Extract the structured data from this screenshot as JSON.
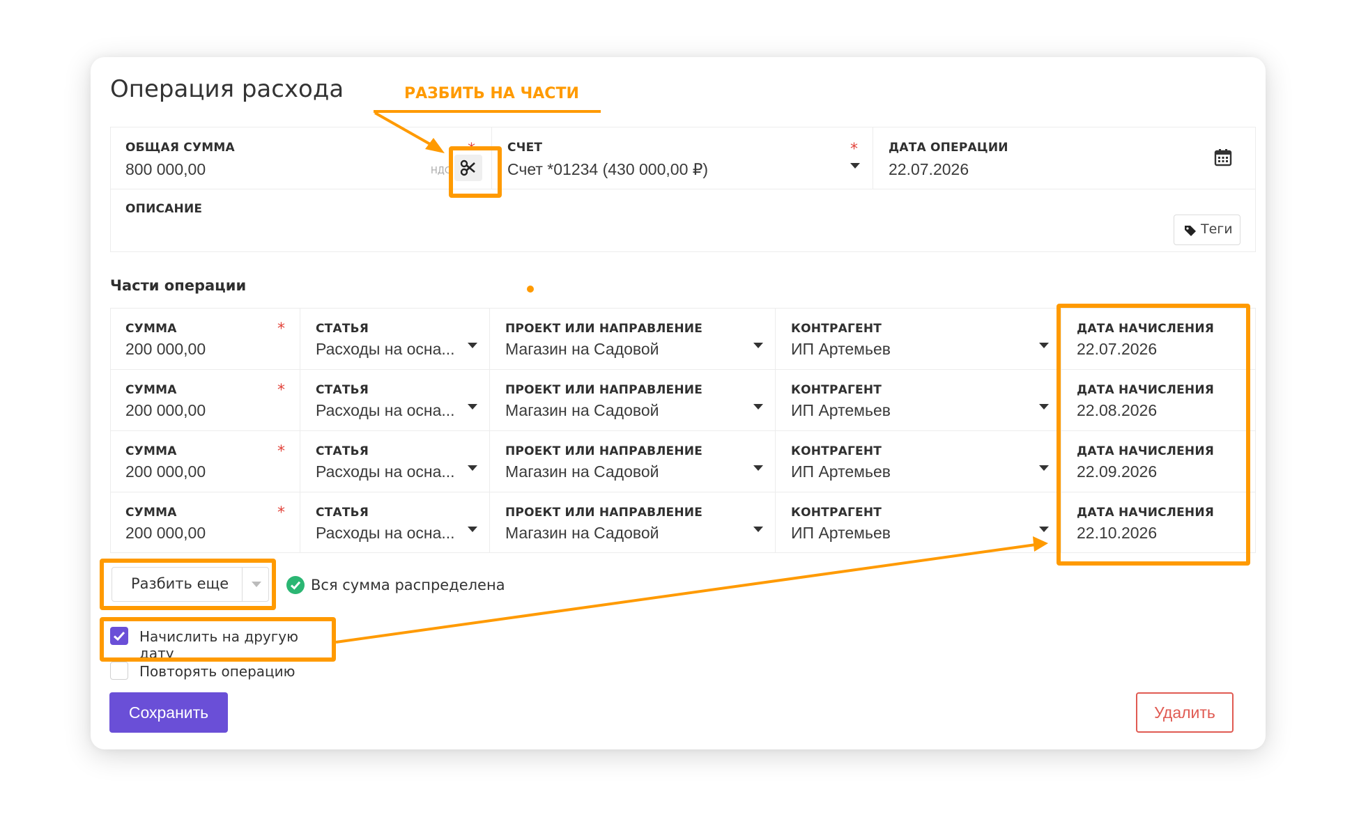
{
  "form": {
    "title": "Операция расхода",
    "total_amount": {
      "label": "ОБЩАЯ СУММА",
      "value": "800 000,00",
      "suffix": "НДС"
    },
    "account": {
      "label": "СЧЕТ",
      "value": "Счет *01234 (430 000,00 ₽)"
    },
    "operation_date": {
      "label": "ДАТА ОПЕРАЦИИ",
      "value": "22.07.2026"
    },
    "description": {
      "label": "ОПИСАНИЕ",
      "value": ""
    },
    "tags_label": "Теги"
  },
  "parts": {
    "heading": "Части операции",
    "columns": {
      "amount": "СУММА",
      "article": "СТАТЬЯ",
      "project": "ПРОЕКТ ИЛИ НАПРАВЛЕНИЕ",
      "counterparty": "КОНТРАГЕНТ",
      "accrual_date": "ДАТА НАЧИСЛЕНИЯ"
    },
    "rows": [
      {
        "amount": "200 000,00",
        "article": "Расходы на осна...",
        "project": "Магазин на Садовой",
        "counterparty": "ИП Артемьев",
        "accrual_date": "22.07.2026"
      },
      {
        "amount": "200 000,00",
        "article": "Расходы на осна...",
        "project": "Магазин на Садовой",
        "counterparty": "ИП Артемьев",
        "accrual_date": "22.08.2026"
      },
      {
        "amount": "200 000,00",
        "article": "Расходы на осна...",
        "project": "Магазин на Садовой",
        "counterparty": "ИП Артемьев",
        "accrual_date": "22.09.2026"
      },
      {
        "amount": "200 000,00",
        "article": "Расходы на осна...",
        "project": "Магазин на Садовой",
        "counterparty": "ИП Артемьев",
        "accrual_date": "22.10.2026"
      }
    ]
  },
  "split_more_label": "Разбить еще",
  "distributed_status": "Вся сумма распределена",
  "accrue_other_date": {
    "label": "Начислить на другую дату",
    "checked": true
  },
  "repeat_operation": {
    "label": "Повторять операцию",
    "checked": false
  },
  "save_label": "Сохранить",
  "delete_label": "Удалить",
  "annotation": {
    "split_label": "РАЗБИТЬ НА ЧАСТИ"
  },
  "colors": {
    "accent": "#6a4fd7",
    "highlight": "#ff9a00",
    "danger": "#e05a52",
    "success": "#2bb673",
    "required": "#e2443b"
  }
}
